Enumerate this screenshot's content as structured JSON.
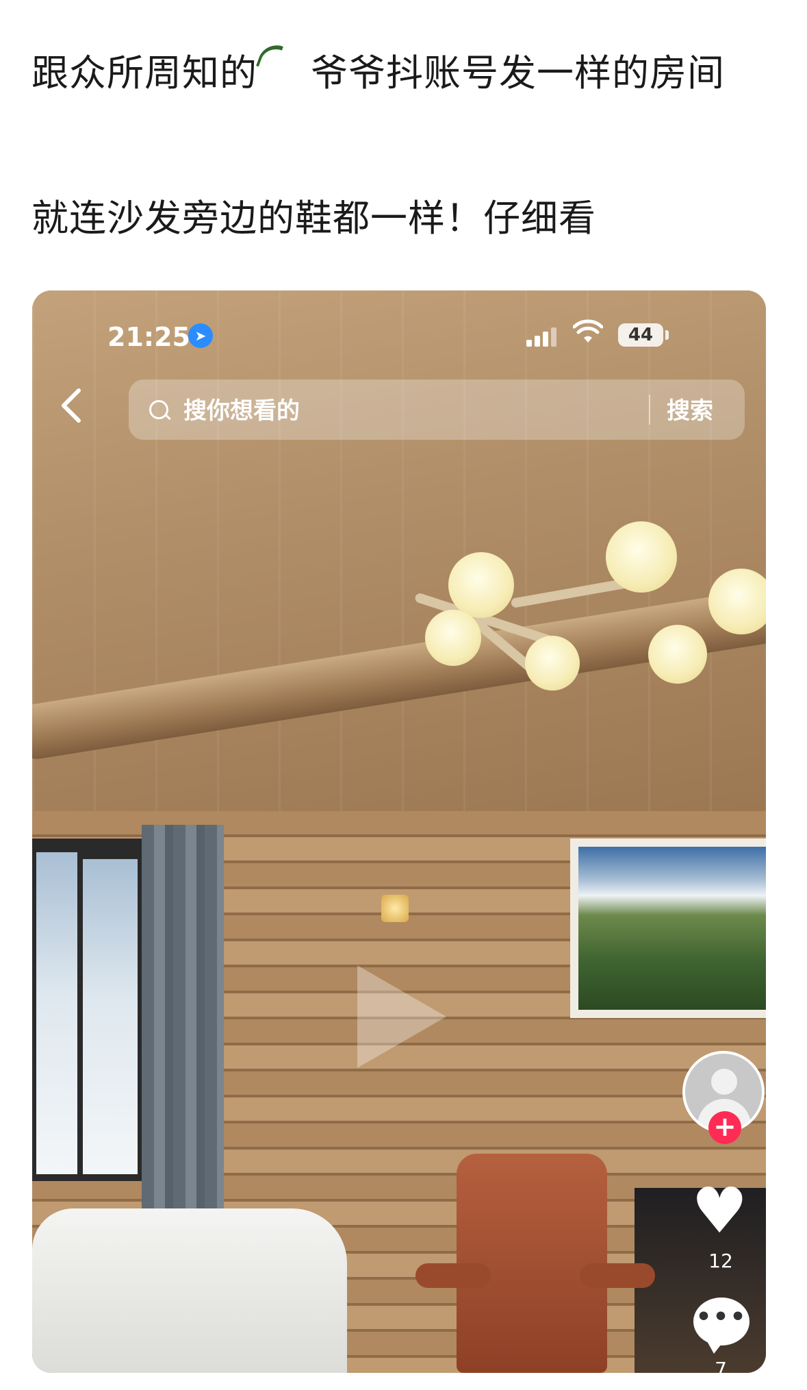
{
  "post": {
    "line1_part1": "跟众所周知的",
    "line1_part2": "爷爷抖账号发一样的房间",
    "line2": "就连沙发旁边的鞋都一样！仔细看"
  },
  "phone_screenshot": {
    "status_bar": {
      "time": "21:25",
      "location_icon": "location-arrow-icon",
      "signal_icon": "cellular-signal-icon",
      "wifi_icon": "wifi-icon",
      "battery": "44"
    },
    "search": {
      "back_icon": "chevron-left-icon",
      "placeholder": "搜你想看的",
      "button_label": "搜索"
    },
    "video": {
      "play_icon": "play-icon"
    },
    "side_actions": {
      "avatar_icon": "user-avatar-icon",
      "follow_icon": "plus-icon",
      "like_icon": "heart-icon",
      "like_count": "12",
      "comment_icon": "comment-bubble-icon",
      "comment_count": "7"
    },
    "colors": {
      "follow_button": "#fe2c55",
      "location_badge": "#2a8cff"
    }
  }
}
